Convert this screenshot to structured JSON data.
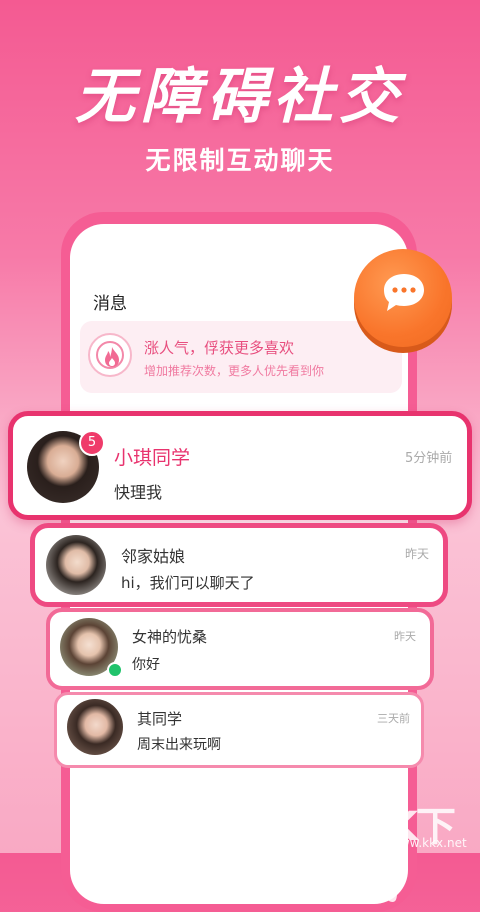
{
  "headline": "无障碍社交",
  "subline": "无限制互动聊天",
  "screen_title": "消息",
  "promo": {
    "title": "涨人气，俘获更多喜欢",
    "subtitle": "增加推荐次数，更多人优先看到你",
    "icon": "fire-icon"
  },
  "fab_icon": "chat-bubble-icon",
  "conversations": [
    {
      "name": "小琪同学",
      "time": "5分钟前",
      "preview": "快理我",
      "unread": "5"
    },
    {
      "name": "邻家姑娘",
      "time": "昨天",
      "preview": "hi，我们可以聊天了"
    },
    {
      "name": "女神的忧桑",
      "time": "昨天",
      "preview": "你好",
      "online": true
    },
    {
      "name": "其同学",
      "time": "三天前",
      "preview": "周末出来玩啊"
    }
  ],
  "watermark": {
    "text": "KK下载",
    "url": "www.kkx.net"
  },
  "colors": {
    "accent": "#e8336e",
    "orange": "#f9752b",
    "online": "#20c36b"
  }
}
